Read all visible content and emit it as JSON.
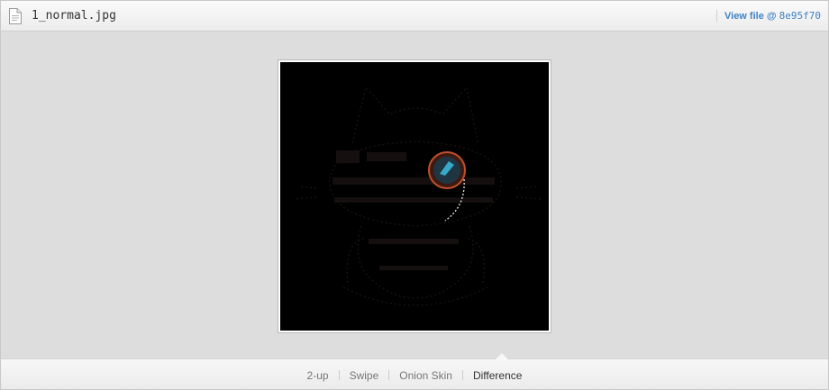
{
  "header": {
    "file_name": "1_normal.jpg",
    "view_file_label": "View file @",
    "commit_sha": "8e95f70"
  },
  "view_modes": [
    {
      "label": "2-up",
      "active": false
    },
    {
      "label": "Swipe",
      "active": false
    },
    {
      "label": "Onion Skin",
      "active": false
    },
    {
      "label": "Difference",
      "active": true
    }
  ],
  "colors": {
    "link": "#4183c4",
    "image_background": "#000000",
    "monocle_ring": "#c0502a",
    "monocle_lens": "#36a9c8"
  },
  "icons": [
    "file-icon"
  ]
}
